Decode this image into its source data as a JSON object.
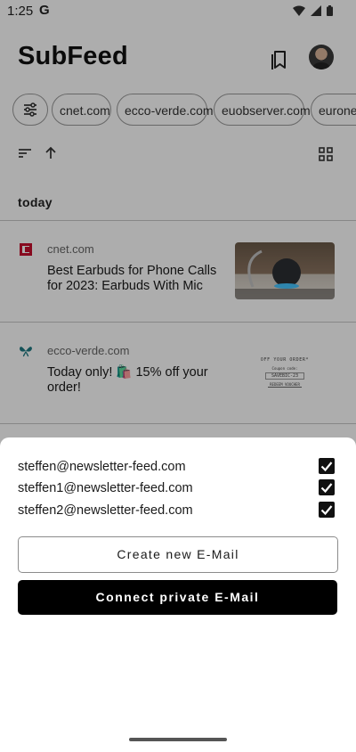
{
  "status": {
    "time": "1:25",
    "g_logo": "G",
    "icons": [
      "wifi-icon",
      "signal-icon",
      "battery-icon"
    ]
  },
  "header": {
    "title": "SubFeed",
    "bookmarks_icon": "bookmark-icon",
    "avatar": "avatar"
  },
  "chips": {
    "filter_icon": "sliders-icon",
    "items": [
      "cnet.com",
      "ecco-verde.com",
      "euobserver.com",
      "euronews"
    ]
  },
  "toolbar": {
    "sort_icon": "sort-icon",
    "direction_icon": "arrow-up-icon",
    "view_icon": "grid-view-icon"
  },
  "feed": {
    "section_label": "today",
    "items": [
      {
        "source": "cnet.com",
        "title": "Best Earbuds for Phone Calls for 2023: Earbuds With Mic",
        "icon": "cnet-logo-icon"
      },
      {
        "source": "ecco-verde.com",
        "title": "Today only! 🛍️ 15% off your order!",
        "icon": "butterfly-logo-icon",
        "thumb_text": {
          "line1": "OFF YOUR ORDER*",
          "line2": "Coupon code:",
          "code": "SAVEBIC-23",
          "cta": "REDEEM VOUCHER"
        }
      }
    ]
  },
  "sheet": {
    "emails": [
      {
        "address": "steffen@newsletter-feed.com",
        "checked": true
      },
      {
        "address": "steffen1@newsletter-feed.com",
        "checked": true
      },
      {
        "address": "steffen2@newsletter-feed.com",
        "checked": true
      }
    ],
    "create_button": "Create new E-Mail",
    "connect_button": "Connect private E-Mail"
  },
  "colors": {
    "scrim": "#000000",
    "accent": "#000000",
    "cnet_red": "#c8102e",
    "ecco_teal": "#1f7a82"
  }
}
